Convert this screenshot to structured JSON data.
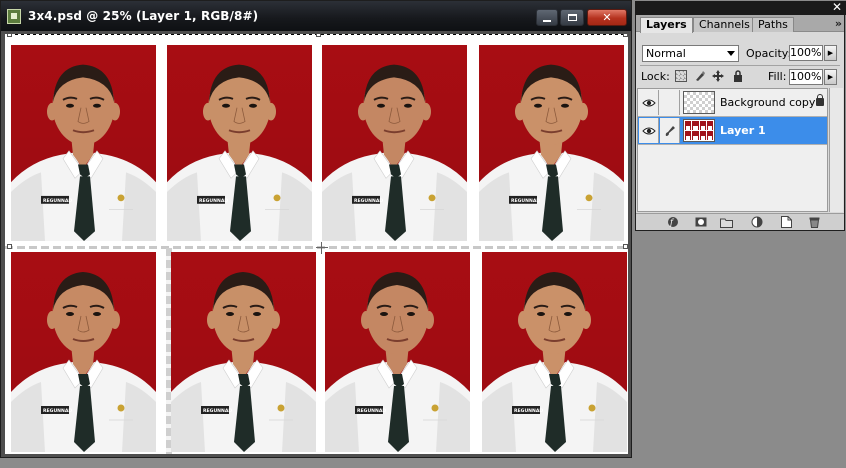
{
  "window": {
    "title": "3x4.psd @ 25% (Layer 1, RGB/8#)",
    "min_icon": "minimize-icon",
    "max_icon": "maximize-icon",
    "close_icon": "close-icon"
  },
  "canvas": {
    "photo_count": 8,
    "badge_text": "REGUNNAD"
  },
  "colors": {
    "photo_background": "#a80d13",
    "selected_layer": "#3c8dea",
    "close_button": "#c03a24"
  },
  "layers_panel": {
    "close_symbol": "✕",
    "menu_symbol": "»",
    "tabs": [
      "Layers",
      "Channels",
      "Paths"
    ],
    "blend_mode": "Normal",
    "opacity_label": "Opacity:",
    "opacity_value": "100%",
    "lock_label": "Lock:",
    "fill_label": "Fill:",
    "fill_value": "100%",
    "layers": [
      {
        "name": "Background copy",
        "visible": true,
        "selected": false,
        "locked": true,
        "thumb": "checker"
      },
      {
        "name": "Layer 1",
        "visible": true,
        "selected": true,
        "locked": false,
        "thumb": "photos"
      }
    ],
    "bottom_icons": [
      "link-layers-icon",
      "layer-style-icon",
      "layer-mask-icon",
      "new-group-icon",
      "adjustment-layer-icon",
      "new-layer-icon",
      "delete-layer-icon"
    ]
  }
}
